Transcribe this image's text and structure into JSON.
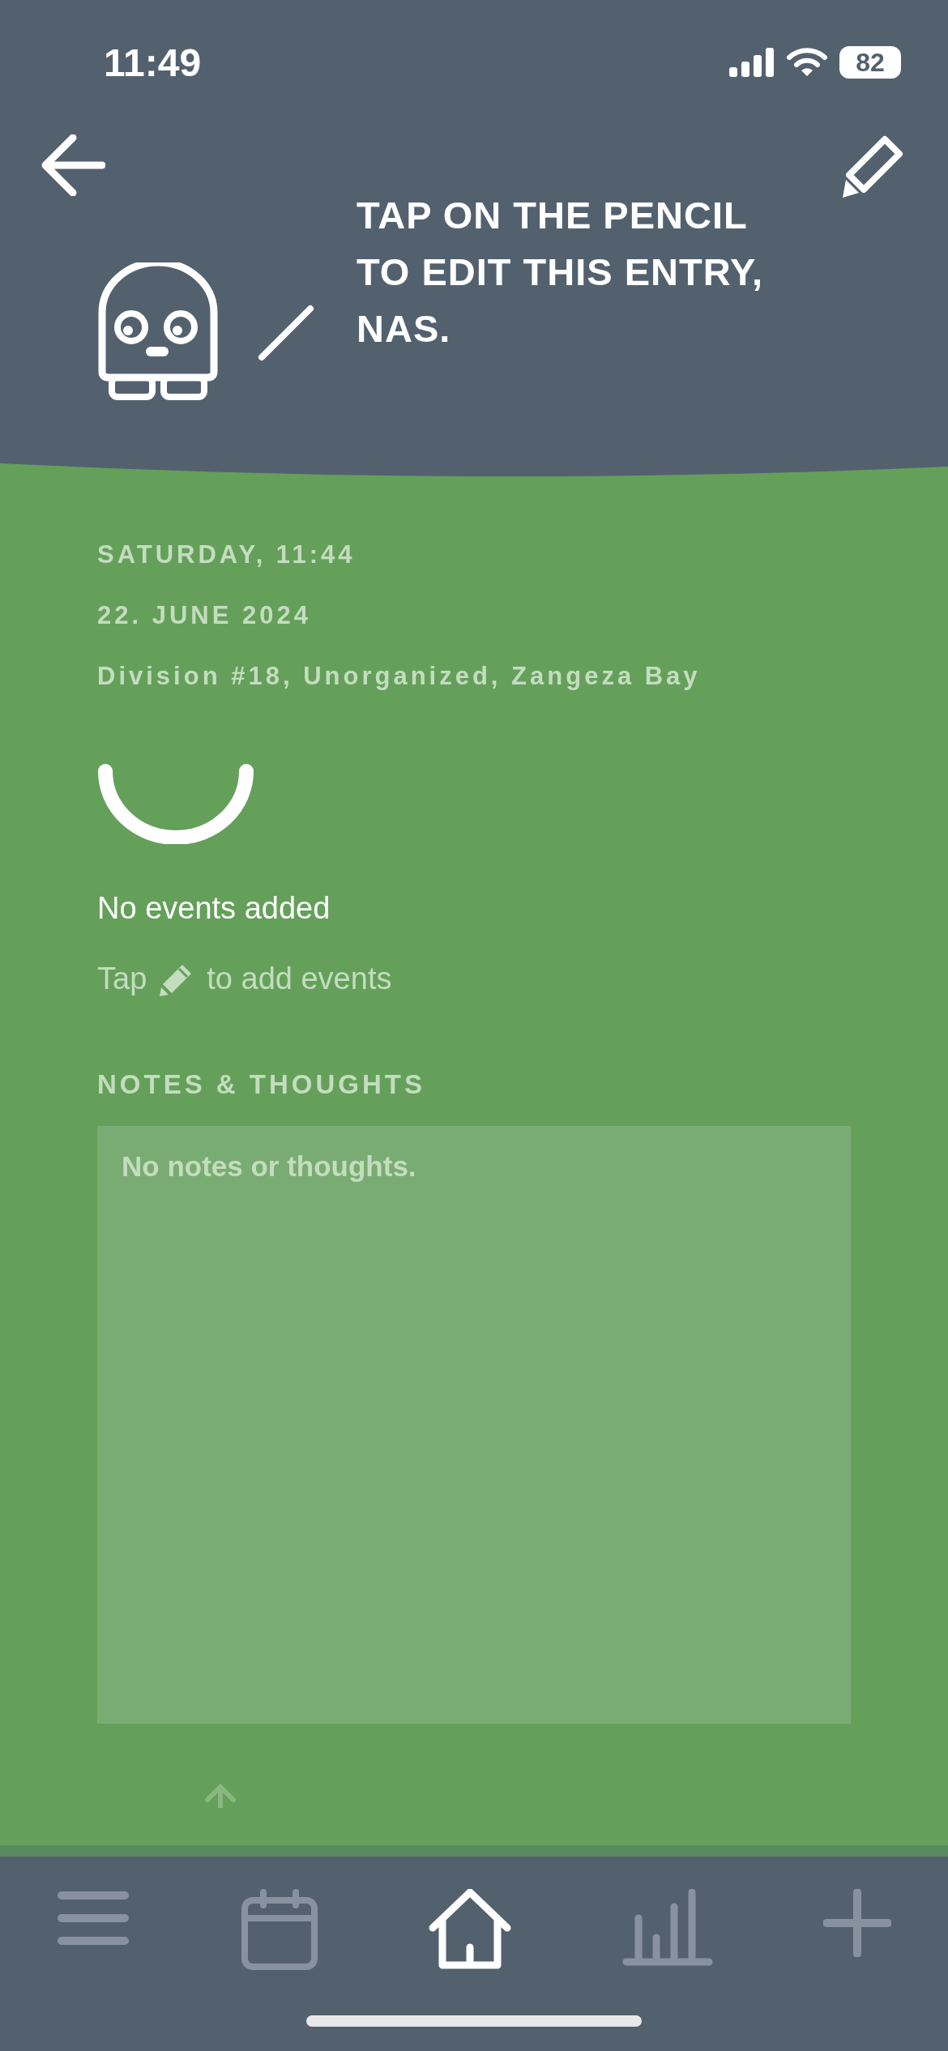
{
  "status_bar": {
    "time": "11:49",
    "battery": "82"
  },
  "header": {
    "tip": "TAP ON THE PENCIL TO EDIT THIS ENTRY, NAS."
  },
  "entry": {
    "day_time": "SATURDAY, 11:44",
    "date": "22. JUNE 2024",
    "location": "Division #18, Unorganized, Zangeza Bay"
  },
  "events": {
    "empty_text": "No events added",
    "hint_before": "Tap",
    "hint_after": "to add events"
  },
  "notes": {
    "heading": "NOTES & THOUGHTS",
    "placeholder": "No notes or thoughts."
  },
  "nav": [
    {
      "kind": "menu",
      "selected": false
    },
    {
      "kind": "calendar",
      "selected": false
    },
    {
      "kind": "home",
      "selected": true
    },
    {
      "kind": "stats",
      "selected": false
    },
    {
      "kind": "add",
      "selected": false
    }
  ]
}
